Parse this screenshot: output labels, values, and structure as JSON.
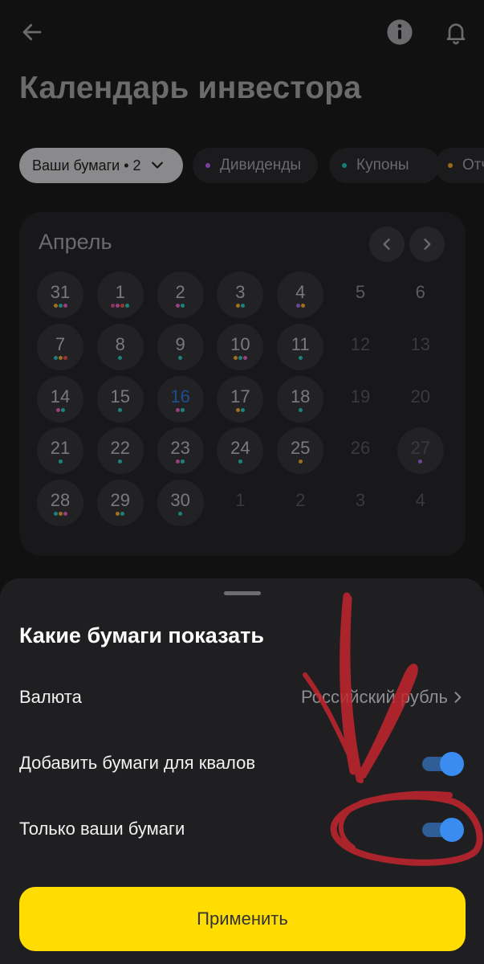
{
  "header": {
    "title": "Календарь инвестора",
    "back_icon": "arrow-left-icon",
    "info_icon": "info-icon",
    "bell_icon": "bell-icon"
  },
  "filters": {
    "my_securities": "Ваши бумаги • 2",
    "dividends": "Дивиденды",
    "coupons": "Купоны",
    "reports": "Отчёты"
  },
  "calendar": {
    "month": "Апрель",
    "days": [
      {
        "n": "31",
        "style": "filled",
        "dots": [
          "#c98a1f",
          "#1aa39a",
          "#c04a9b"
        ]
      },
      {
        "n": "1",
        "style": "filled",
        "dots": [
          "#b13b7c",
          "#c04a9b",
          "#c63a3a",
          "#1aa39a"
        ]
      },
      {
        "n": "2",
        "style": "filled",
        "dots": [
          "#c04a9b",
          "#1aa39a"
        ]
      },
      {
        "n": "3",
        "style": "filled",
        "dots": [
          "#c98a1f",
          "#1aa39a"
        ]
      },
      {
        "n": "4",
        "style": "filled",
        "dots": [
          "#8a4fc4",
          "#c98a1f"
        ]
      },
      {
        "n": "5",
        "style": "plain",
        "dots": []
      },
      {
        "n": "6",
        "style": "plain",
        "dots": []
      },
      {
        "n": "7",
        "style": "filled",
        "dots": [
          "#1aa39a",
          "#c98a1f",
          "#c63a3a"
        ]
      },
      {
        "n": "8",
        "style": "filled",
        "dots": [
          "#1aa39a"
        ]
      },
      {
        "n": "9",
        "style": "filled",
        "dots": [
          "#1aa39a"
        ]
      },
      {
        "n": "10",
        "style": "filled",
        "dots": [
          "#c98a1f",
          "#1aa39a",
          "#c04a9b"
        ]
      },
      {
        "n": "11",
        "style": "filled",
        "dots": [
          "#1aa39a"
        ]
      },
      {
        "n": "12",
        "style": "muted",
        "dots": []
      },
      {
        "n": "13",
        "style": "muted",
        "dots": []
      },
      {
        "n": "14",
        "style": "filled",
        "dots": [
          "#c04a9b",
          "#1aa39a"
        ]
      },
      {
        "n": "15",
        "style": "filled",
        "dots": [
          "#1aa39a"
        ]
      },
      {
        "n": "16",
        "style": "today",
        "dots": [
          "#c04a9b",
          "#1aa39a"
        ]
      },
      {
        "n": "17",
        "style": "filled",
        "dots": [
          "#c98a1f",
          "#1aa39a"
        ]
      },
      {
        "n": "18",
        "style": "filled",
        "dots": [
          "#1aa39a"
        ]
      },
      {
        "n": "19",
        "style": "muted",
        "dots": []
      },
      {
        "n": "20",
        "style": "muted",
        "dots": []
      },
      {
        "n": "21",
        "style": "filled",
        "dots": [
          "#1aa39a"
        ]
      },
      {
        "n": "22",
        "style": "filled",
        "dots": [
          "#1aa39a"
        ]
      },
      {
        "n": "23",
        "style": "filled",
        "dots": [
          "#c04a9b",
          "#1aa39a"
        ]
      },
      {
        "n": "24",
        "style": "filled",
        "dots": [
          "#1aa39a"
        ]
      },
      {
        "n": "25",
        "style": "filled",
        "dots": [
          "#c98a1f"
        ]
      },
      {
        "n": "26",
        "style": "muted",
        "dots": []
      },
      {
        "n": "27",
        "style": "filled-muted",
        "dots": [
          "#8a4fc4"
        ]
      },
      {
        "n": "28",
        "style": "filled",
        "dots": [
          "#1aa39a",
          "#c98a1f",
          "#c04a9b"
        ]
      },
      {
        "n": "29",
        "style": "filled",
        "dots": [
          "#c98a1f",
          "#1aa39a"
        ]
      },
      {
        "n": "30",
        "style": "filled",
        "dots": [
          "#1aa39a"
        ]
      },
      {
        "n": "1",
        "style": "muted",
        "dots": []
      },
      {
        "n": "2",
        "style": "muted",
        "dots": []
      },
      {
        "n": "3",
        "style": "muted",
        "dots": []
      },
      {
        "n": "4",
        "style": "muted",
        "dots": []
      }
    ]
  },
  "sheet": {
    "title": "Какие бумаги показать",
    "currency_label": "Валюта",
    "currency_value": "Российский рубль",
    "qual_label": "Добавить бумаги для квалов",
    "qual_on": true,
    "own_label": "Только ваши бумаги",
    "own_on": true,
    "apply_label": "Применить"
  },
  "colors": {
    "accent_yellow": "#ffdd00",
    "toggle_blue": "#3b8cf0",
    "dividend_dot": "#9b4fc4",
    "coupon_dot": "#1aa39a",
    "report_dot": "#c98a1f",
    "annotation_red": "#c4262f"
  }
}
